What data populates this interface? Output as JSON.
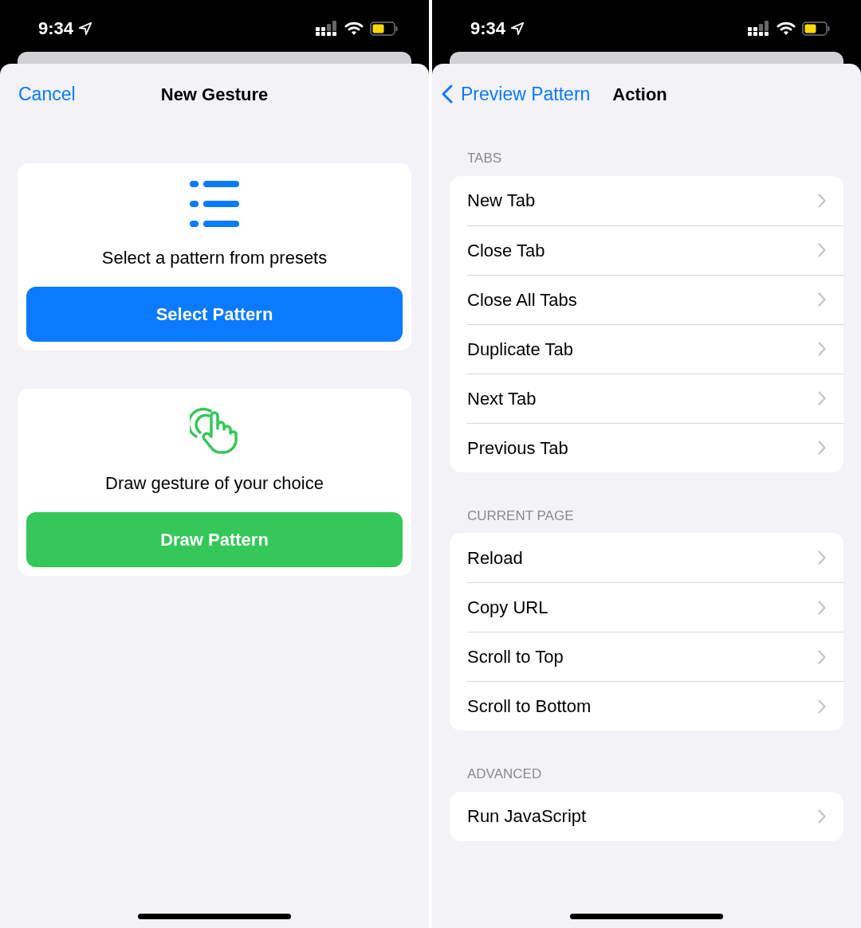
{
  "left_screen": {
    "status_bar": {
      "time": "9:34"
    },
    "nav": {
      "cancel": "Cancel",
      "title": "New Gesture"
    },
    "cards": [
      {
        "kind": "list",
        "text": "Select a pattern from presets",
        "button": "Select Pattern",
        "color": "#0a7aff"
      },
      {
        "kind": "hand",
        "text": "Draw gesture of your choice",
        "button": "Draw Pattern",
        "color": "#34c759"
      }
    ]
  },
  "right_screen": {
    "status_bar": {
      "time": "9:34"
    },
    "nav": {
      "back": "Preview Pattern",
      "title": "Action"
    },
    "sections": [
      {
        "header": "TABS",
        "items": [
          "New Tab",
          "Close Tab",
          "Close All Tabs",
          "Duplicate Tab",
          "Next Tab",
          "Previous Tab"
        ]
      },
      {
        "header": "CURRENT PAGE",
        "items": [
          "Reload",
          "Copy URL",
          "Scroll to Top",
          "Scroll to Bottom"
        ]
      },
      {
        "header": "ADVANCED",
        "items": [
          "Run JavaScript"
        ]
      }
    ]
  }
}
